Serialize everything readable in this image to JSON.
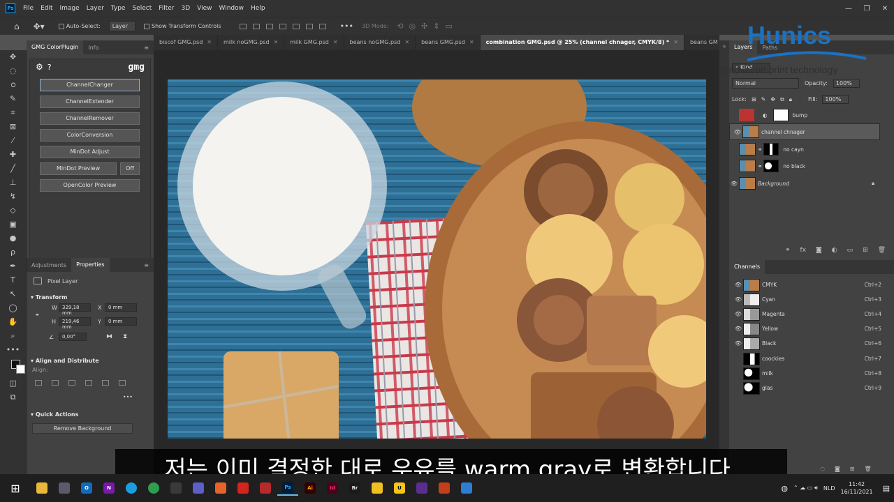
{
  "app": {
    "logo": "Ps",
    "menus": [
      "File",
      "Edit",
      "Image",
      "Layer",
      "Type",
      "Select",
      "Filter",
      "3D",
      "View",
      "Window",
      "Help"
    ],
    "window_controls": [
      "—",
      "❐",
      "✕"
    ]
  },
  "options": {
    "auto_select_label": "Auto-Select:",
    "auto_select_value": "Layer",
    "transform_label": "Show Transform Controls",
    "threed_label": "3D Mode:"
  },
  "tabs": [
    {
      "label": "biscof GMG.psd"
    },
    {
      "label": "milk noGMG.psd"
    },
    {
      "label": "milk GMG.psd"
    },
    {
      "label": "beans noGMG.psd"
    },
    {
      "label": "beans GMG.psd"
    },
    {
      "label": "combination GMG.psd @ 25% (channel chnager, CMYK/8) *",
      "active": true
    },
    {
      "label": "beans GM"
    }
  ],
  "left_panel": {
    "tabs": [
      "GMG ColorPlugin",
      "Info"
    ],
    "brand": "gmg",
    "buttons": [
      "ChannelChanger",
      "ChannelExtender",
      "ChannelRemover",
      "ColorConversion",
      "MinDot Adjust"
    ],
    "mindot_preview": "MinDot Preview",
    "off_label": "Off",
    "opencolor": "OpenColor Preview"
  },
  "properties": {
    "tabs": [
      "Adjustments",
      "Properties"
    ],
    "layer_type": "Pixel Layer",
    "transform_title": "Transform",
    "w_label": "W",
    "w_value": "329,18 mm",
    "x_label": "X",
    "x_value": "0 mm",
    "h_label": "H",
    "h_value": "219,46 mm",
    "y_label": "Y",
    "y_value": "0 mm",
    "angle_value": "0,00°",
    "align_title": "Align and Distribute",
    "align_label": "Align:",
    "quick_actions_title": "Quick Actions",
    "remove_bg": "Remove Background",
    "more": "•••"
  },
  "layers_panel": {
    "tabs": [
      "Layers",
      "Paths"
    ],
    "kind_label": "Kind",
    "blend_mode": "Normal",
    "opacity_label": "Opacity:",
    "opacity_value": "100%",
    "lock_label": "Lock:",
    "fill_label": "Fill:",
    "fill_value": "100%",
    "layers": [
      {
        "name": "bump",
        "visible": false
      },
      {
        "name": "channel chnager",
        "visible": true,
        "selected": true
      },
      {
        "name": "no cayn",
        "visible": false
      },
      {
        "name": "no black",
        "visible": false
      },
      {
        "name": "Background",
        "visible": true,
        "locked": true
      }
    ]
  },
  "channels_panel": {
    "title": "Channels",
    "channels": [
      {
        "name": "CMYK",
        "shortcut": "Ctrl+2",
        "visible": true
      },
      {
        "name": "Cyan",
        "shortcut": "Ctrl+3",
        "visible": true
      },
      {
        "name": "Magenta",
        "shortcut": "Ctrl+4",
        "visible": true
      },
      {
        "name": "Yellow",
        "shortcut": "Ctrl+5",
        "visible": true
      },
      {
        "name": "Black",
        "shortcut": "Ctrl+6",
        "visible": true
      },
      {
        "name": "coockies",
        "shortcut": "Ctrl+7",
        "visible": false
      },
      {
        "name": "milk",
        "shortcut": "Ctrl+8",
        "visible": false
      },
      {
        "name": "glas",
        "shortcut": "Ctrl+9",
        "visible": false
      }
    ]
  },
  "status": {
    "zoom": "25%"
  },
  "subtitle": "저는 이미 결정한 대로 우유를  warm gray로 변환합니다.",
  "watermark": {
    "logo": "Hunics",
    "tagline": "Innovation print technology"
  },
  "taskbar": {
    "language": "NLD",
    "time": "11:42",
    "date": "16/11/2021"
  },
  "colors": {
    "accent": "#31a8ff",
    "selection": "#5a5a5a",
    "panel": "#424242",
    "brand_blue": "#1a72c4"
  }
}
